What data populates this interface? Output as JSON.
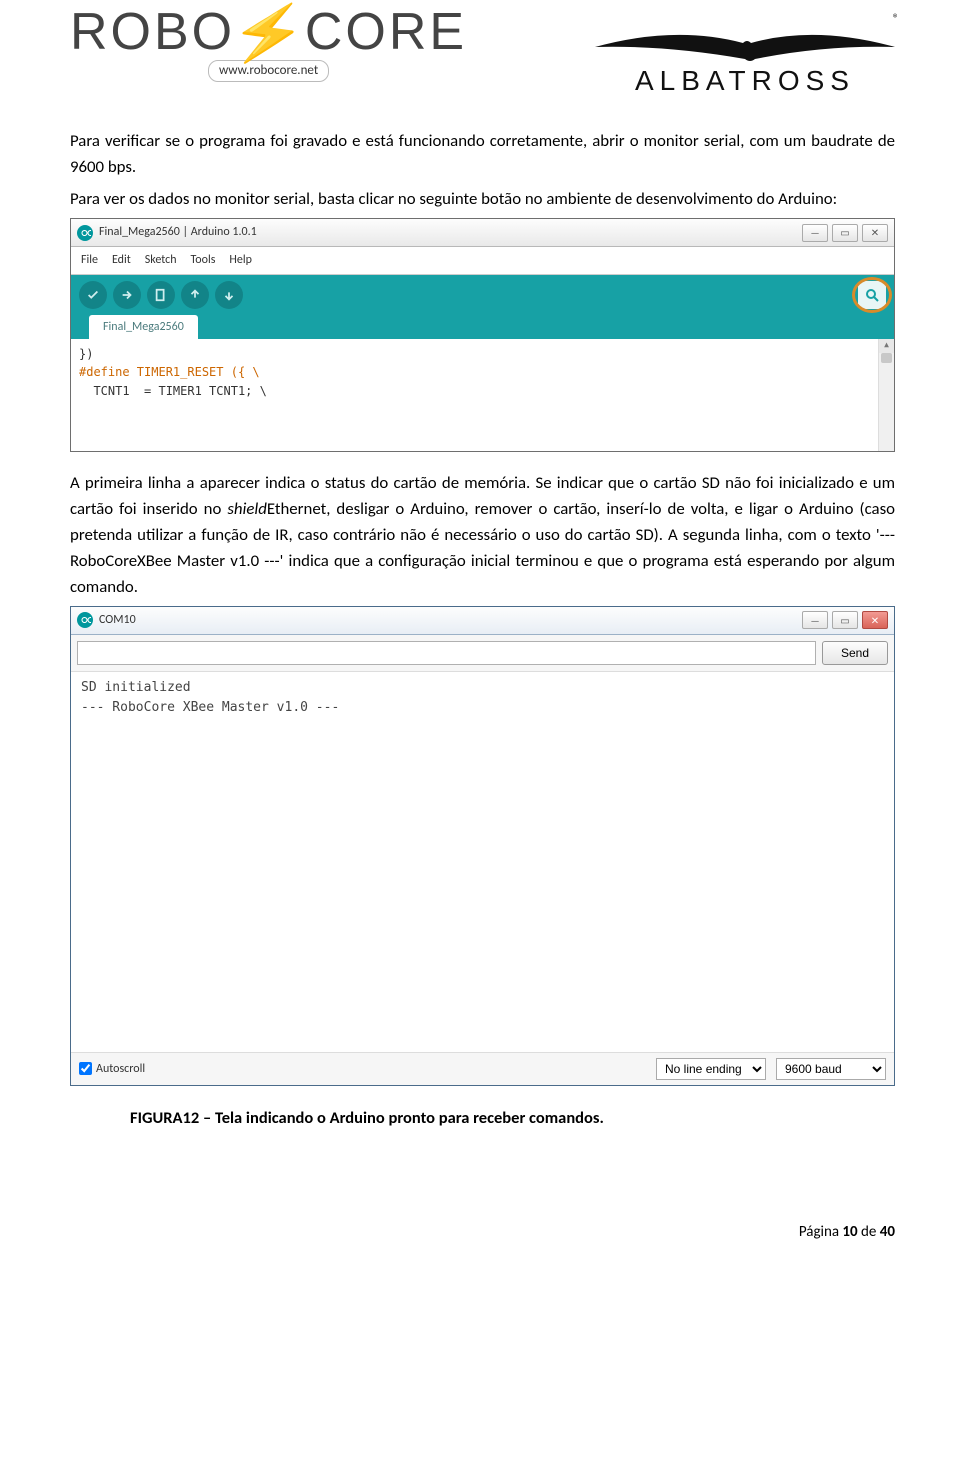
{
  "header": {
    "robocore_name_left": "ROBO",
    "robocore_name_right": "CORE",
    "robocore_url": "www.robocore.net",
    "albatross_name": "ALBATROSS",
    "reg_mark": "®"
  },
  "body": {
    "p1": "Para verificar se o programa foi gravado e está funcionando corretamente, abrir o monitor serial, com um baudrate de 9600 bps.",
    "p2": "Para ver os dados no monitor serial, basta clicar no seguinte botão no ambiente de desenvolvimento do Arduino:",
    "p3_pre": "A primeira linha a aparecer indica o status do cartão de memória. Se indicar que o cartão SD não foi inicializado e um cartão foi inserido no ",
    "p3_em": "shield",
    "p3_post": "Ethernet, desligar o Arduino, remover o cartão, inserí-lo de volta, e ligar o Arduino (caso pretenda utilizar a função de IR, caso contrário não é necessário o uso do cartão SD). A segunda linha, com o texto '--- RoboCoreXBee Master v1.0 ---' indica que a configuração inicial terminou e que o programa está esperando por algum comando."
  },
  "ide_window": {
    "title": "Final_Mega2560 | Arduino 1.0.1",
    "menu": [
      "File",
      "Edit",
      "Sketch",
      "Tools",
      "Help"
    ],
    "tab": "Final_Mega2560",
    "code_lines": [
      "})",
      "",
      "#define TIMER1_RESET ({ \\",
      "  TCNT1  = TIMER1 TCNT1; \\"
    ],
    "btn_min": "—",
    "btn_max": "▭",
    "btn_close": "✕"
  },
  "serial_window": {
    "title": "COM10",
    "send_label": "Send",
    "output_lines": [
      "SD initialized",
      "--- RoboCore XBee Master v1.0 ---"
    ],
    "autoscroll_label": "Autoscroll",
    "autoscroll_checked": true,
    "line_ending": "No line ending",
    "baud": "9600 baud",
    "btn_min": "—",
    "btn_max": "▭",
    "btn_close": "✕"
  },
  "figure_caption": "FIGURA12 – Tela indicando o Arduino pronto para receber comandos.",
  "footer": {
    "prefix": "Página ",
    "page": "10",
    "of": " de ",
    "total": "40"
  }
}
